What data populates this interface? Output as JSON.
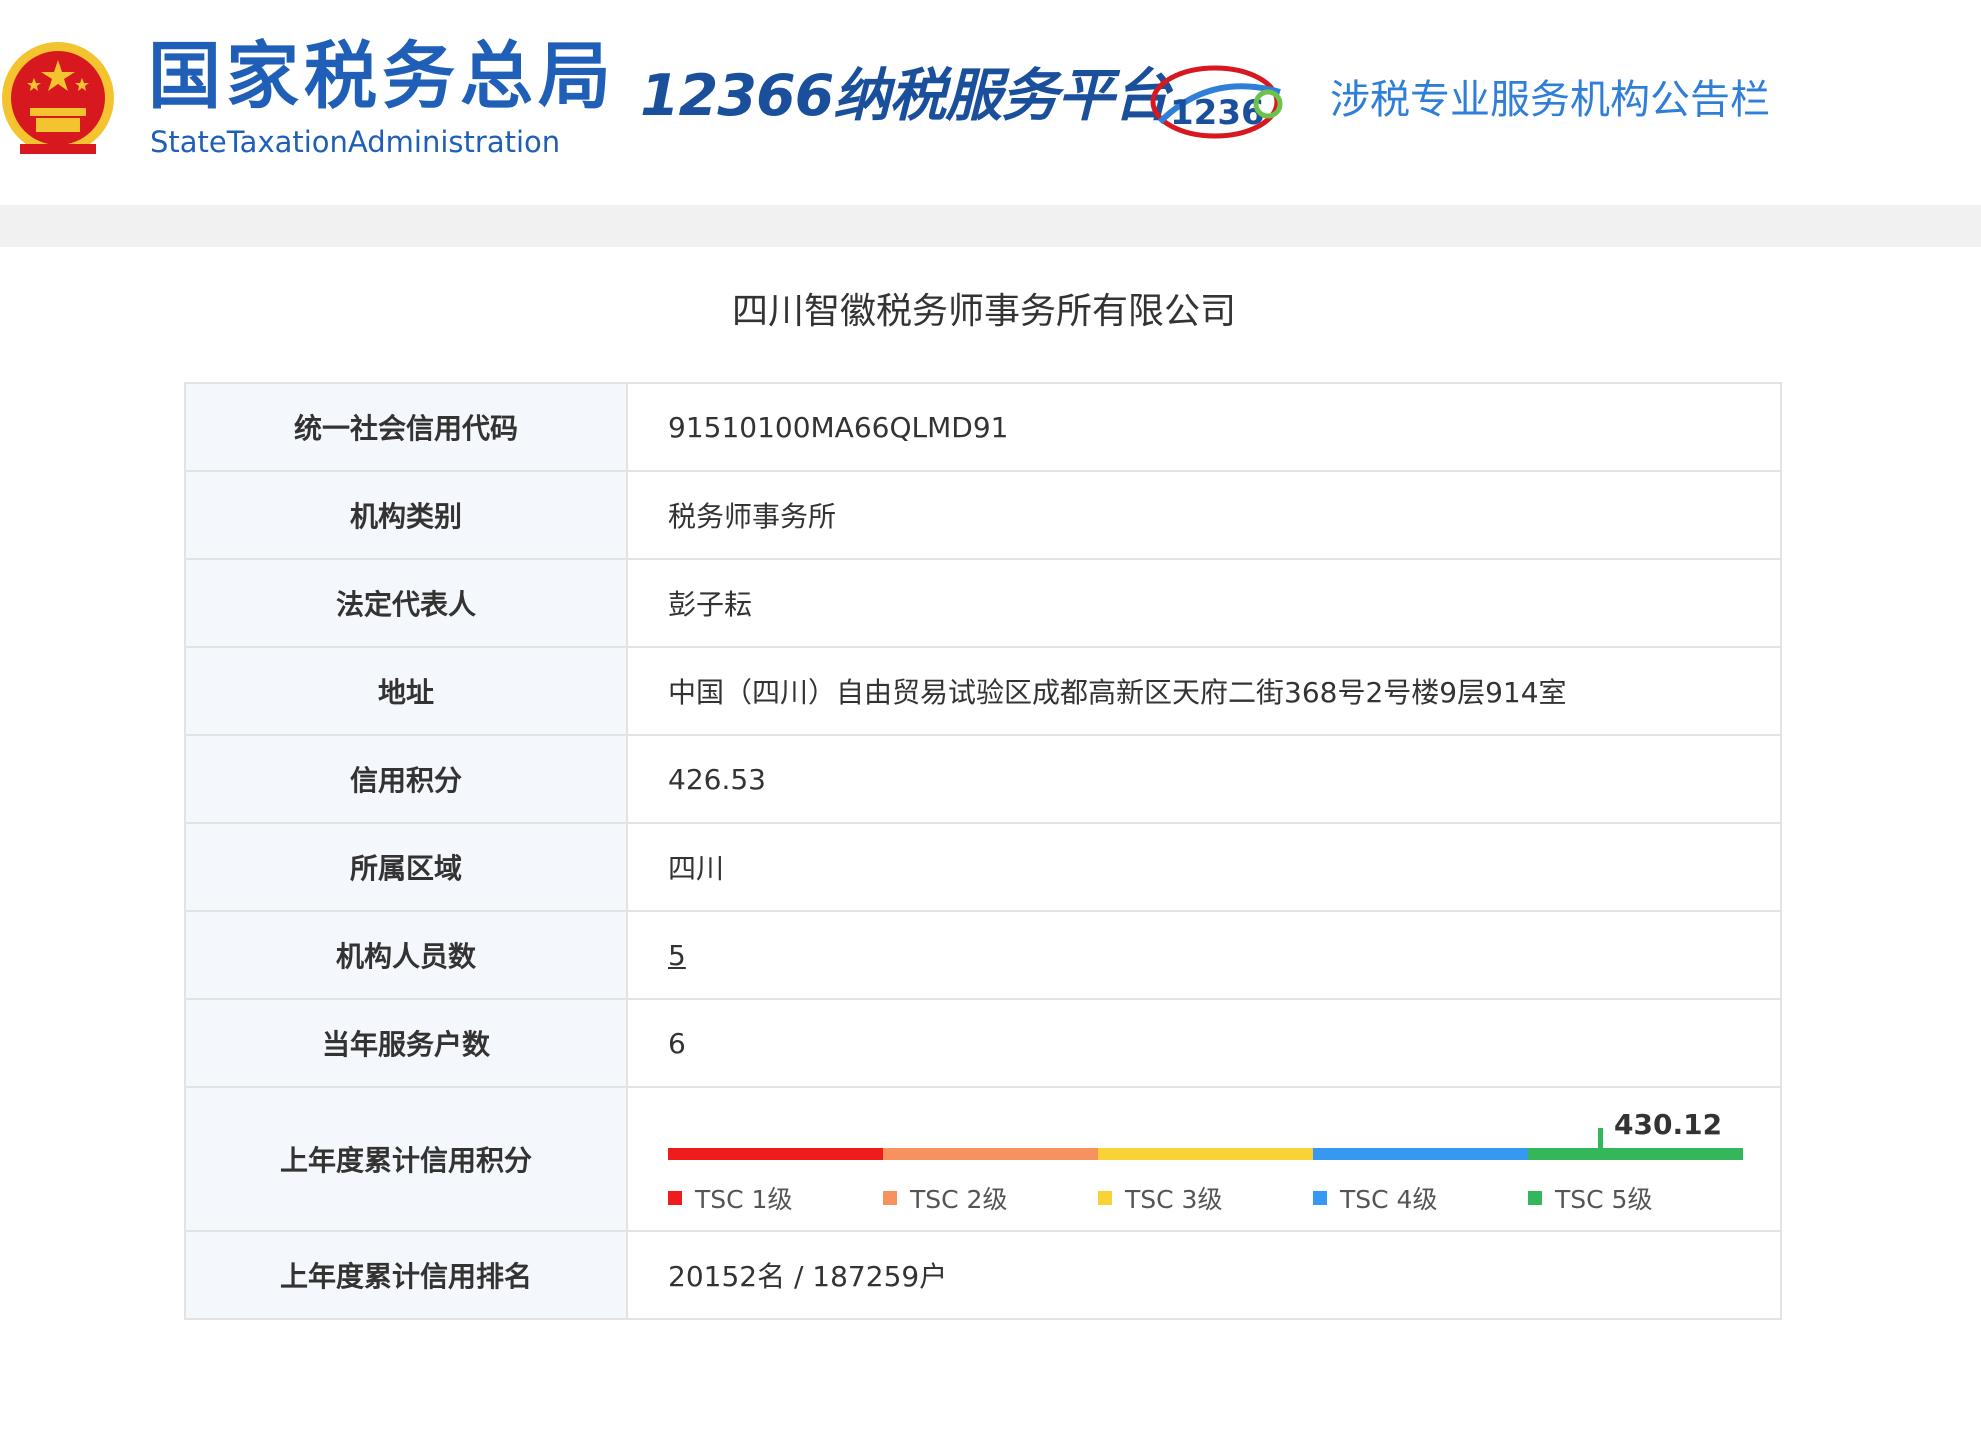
{
  "header": {
    "agency_cn": "国家税务总局",
    "agency_en": "StateTaxationAdministration",
    "platform_title": "12366纳税服务平台",
    "platform_logo_text": "1236",
    "board_title": "涉税专业服务机构公告栏"
  },
  "company": {
    "name": "四川智徽税务师事务所有限公司"
  },
  "details": [
    {
      "label": "统一社会信用代码",
      "value": "91510100MA66QLMD91"
    },
    {
      "label": "机构类别",
      "value": "税务师事务所"
    },
    {
      "label": "法定代表人",
      "value": "彭子耘"
    },
    {
      "label": "地址",
      "value": "中国（四川）自由贸易试验区成都高新区天府二街368号2号楼9层914室"
    },
    {
      "label": "信用积分",
      "value": "426.53"
    },
    {
      "label": "所属区域",
      "value": "四川"
    },
    {
      "label": "机构人员数",
      "value": "5"
    },
    {
      "label": "当年服务户数",
      "value": "6"
    }
  ],
  "credit": {
    "label": "上年度累计信用积分",
    "value": "430.12",
    "position_fraction": 0.865,
    "levels": [
      {
        "name": "TSC 1级",
        "color": "#ee1c1c"
      },
      {
        "name": "TSC 2级",
        "color": "#f7925e"
      },
      {
        "name": "TSC 3级",
        "color": "#f9d236"
      },
      {
        "name": "TSC 4级",
        "color": "#3798f2"
      },
      {
        "name": "TSC 5级",
        "color": "#33b75a"
      }
    ]
  },
  "ranking": {
    "label": "上年度累计信用排名",
    "value": "20152名 / 187259户"
  },
  "colors": {
    "brand_blue": "#1f5fb8",
    "board_blue": "#2f7fd8",
    "emblem_red": "#d7181f",
    "emblem_gold": "#f4c430"
  }
}
